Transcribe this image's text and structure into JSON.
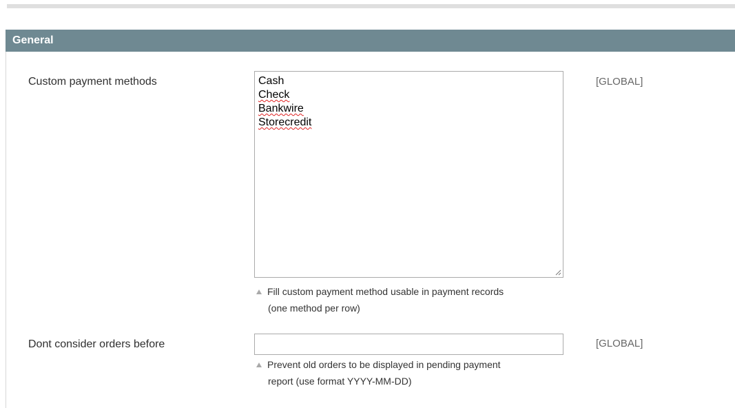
{
  "section": {
    "title": "General"
  },
  "fields": {
    "payment_methods": {
      "label": "Custom payment methods",
      "scope": "[GLOBAL]",
      "lines": [
        "Cash",
        "Check",
        "Bankwire",
        "Storecredit"
      ],
      "note_line1": "Fill custom payment method usable in payment records",
      "note_line2": "(one method per row)"
    },
    "orders_before": {
      "label": "Dont consider orders before",
      "scope": "[GLOBAL]",
      "value": "",
      "note_line1": "Prevent old orders to be displayed in pending payment",
      "note_line2": "report (use format YYYY-MM-DD)"
    }
  },
  "colors": {
    "header_bg": "#6f8992",
    "header_text": "#ffffff",
    "spellcheck_underline": "#e02020"
  },
  "icons": {
    "note_marker": "triangle-up-icon",
    "resize": "resize-grip-icon"
  }
}
